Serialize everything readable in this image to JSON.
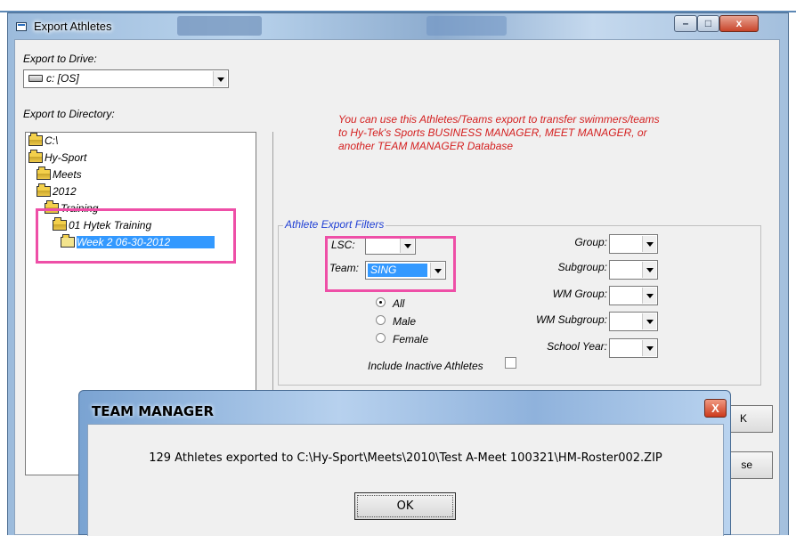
{
  "window": {
    "title": "Export Athletes",
    "controls": {
      "minimize": "–",
      "maximize": "□",
      "close": "x"
    }
  },
  "export_to_drive": {
    "label": "Export to Drive:",
    "value": "c: [OS]",
    "icon": "drive-icon"
  },
  "export_to_directory": {
    "label": "Export to Directory:",
    "items": [
      {
        "label": "C:\\",
        "icon": "folder-open-icon"
      },
      {
        "label": "Hy-Sport",
        "icon": "folder-open-icon"
      },
      {
        "label": "Meets",
        "icon": "folder-open-icon"
      },
      {
        "label": "2012",
        "icon": "folder-open-icon"
      },
      {
        "label": "Training",
        "icon": "folder-open-icon"
      },
      {
        "label": "01 Hytek Training",
        "icon": "folder-open-icon"
      },
      {
        "label": "Week 2 06-30-2012",
        "icon": "folder-icon",
        "selected": true
      }
    ]
  },
  "info_text": {
    "line1": "You can use this Athletes/Teams export to transfer swimmers/teams",
    "line2": "to Hy-Tek's Sports BUSINESS MANAGER, MEET MANAGER, or",
    "line3": "another TEAM MANAGER Database"
  },
  "filters": {
    "legend": "Athlete Export Filters",
    "lsc": {
      "label": "LSC:",
      "value": ""
    },
    "team": {
      "label": "Team:",
      "value": "SING"
    },
    "gender": {
      "options": [
        "All",
        "Male",
        "Female"
      ],
      "selected": "All"
    },
    "include_inactive": {
      "label": "Include Inactive Athletes",
      "checked": false
    },
    "group": {
      "label": "Group:",
      "value": ""
    },
    "subgroup": {
      "label": "Subgroup:",
      "value": ""
    },
    "wm_group": {
      "label": "WM Group:",
      "value": ""
    },
    "wm_subgroup": {
      "label": "WM Subgroup:",
      "value": ""
    },
    "school_year": {
      "label": "School Year:",
      "value": ""
    }
  },
  "buttons": {
    "ok_partial": "K",
    "close_partial": "se"
  },
  "dialog": {
    "title": "TEAM MANAGER",
    "message": "129 Athletes exported to C:\\Hy-Sport\\Meets\\2010\\Test A-Meet 100321\\HM-Roster002.ZIP",
    "ok_label": "OK",
    "close_glyph": "X"
  },
  "highlight_color": "#ee4fa7",
  "info_color": "#d42020",
  "legend_color": "#1f3fd4"
}
